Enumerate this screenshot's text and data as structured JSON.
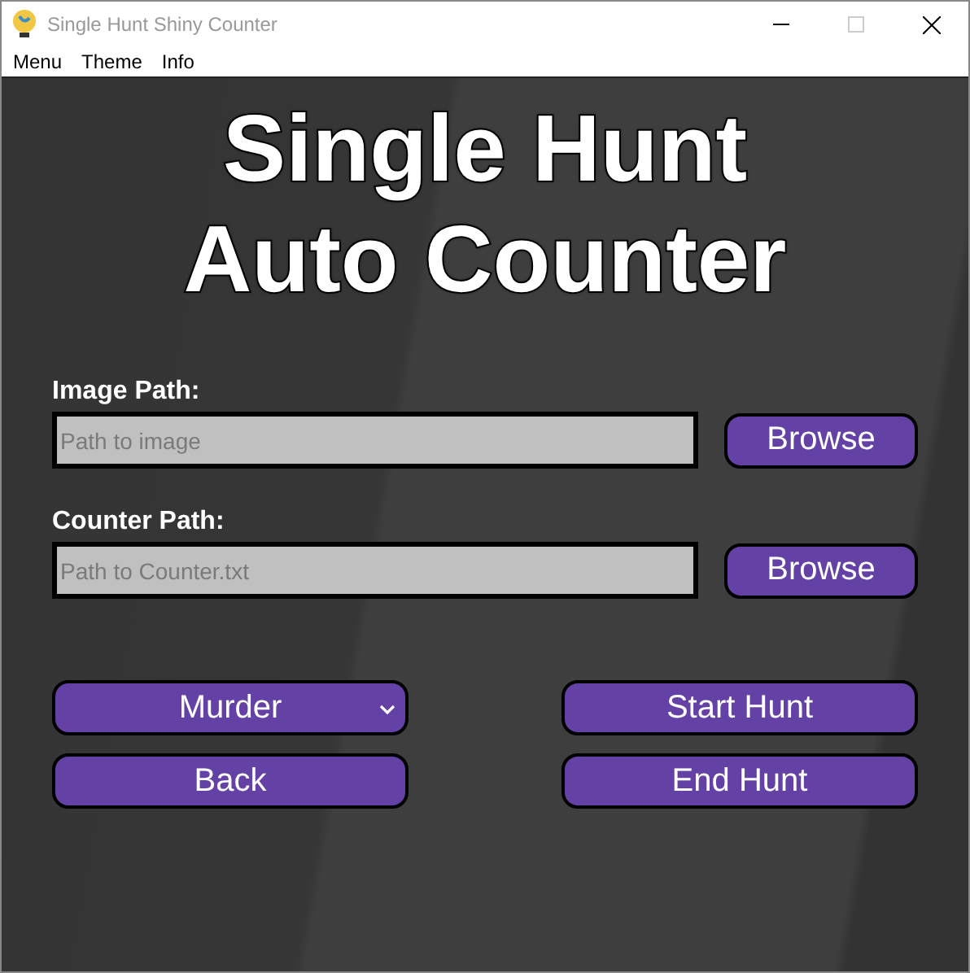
{
  "window": {
    "title": "Single Hunt Shiny Counter",
    "maximize_disabled": true
  },
  "menu": [
    "Menu",
    "Theme",
    "Info"
  ],
  "heading": [
    "Single Hunt",
    "Auto Counter"
  ],
  "fields": [
    {
      "label": "Image Path:",
      "placeholder": "Path to image",
      "button": "Browse"
    },
    {
      "label": "Counter Path:",
      "placeholder": "Path to Counter.txt",
      "button": "Browse"
    }
  ],
  "controls": [
    {
      "kind": "select",
      "label": "Murder"
    },
    {
      "kind": "button",
      "label": "Start Hunt"
    },
    {
      "kind": "button",
      "label": "Back"
    },
    {
      "kind": "button",
      "label": "End Hunt"
    }
  ]
}
